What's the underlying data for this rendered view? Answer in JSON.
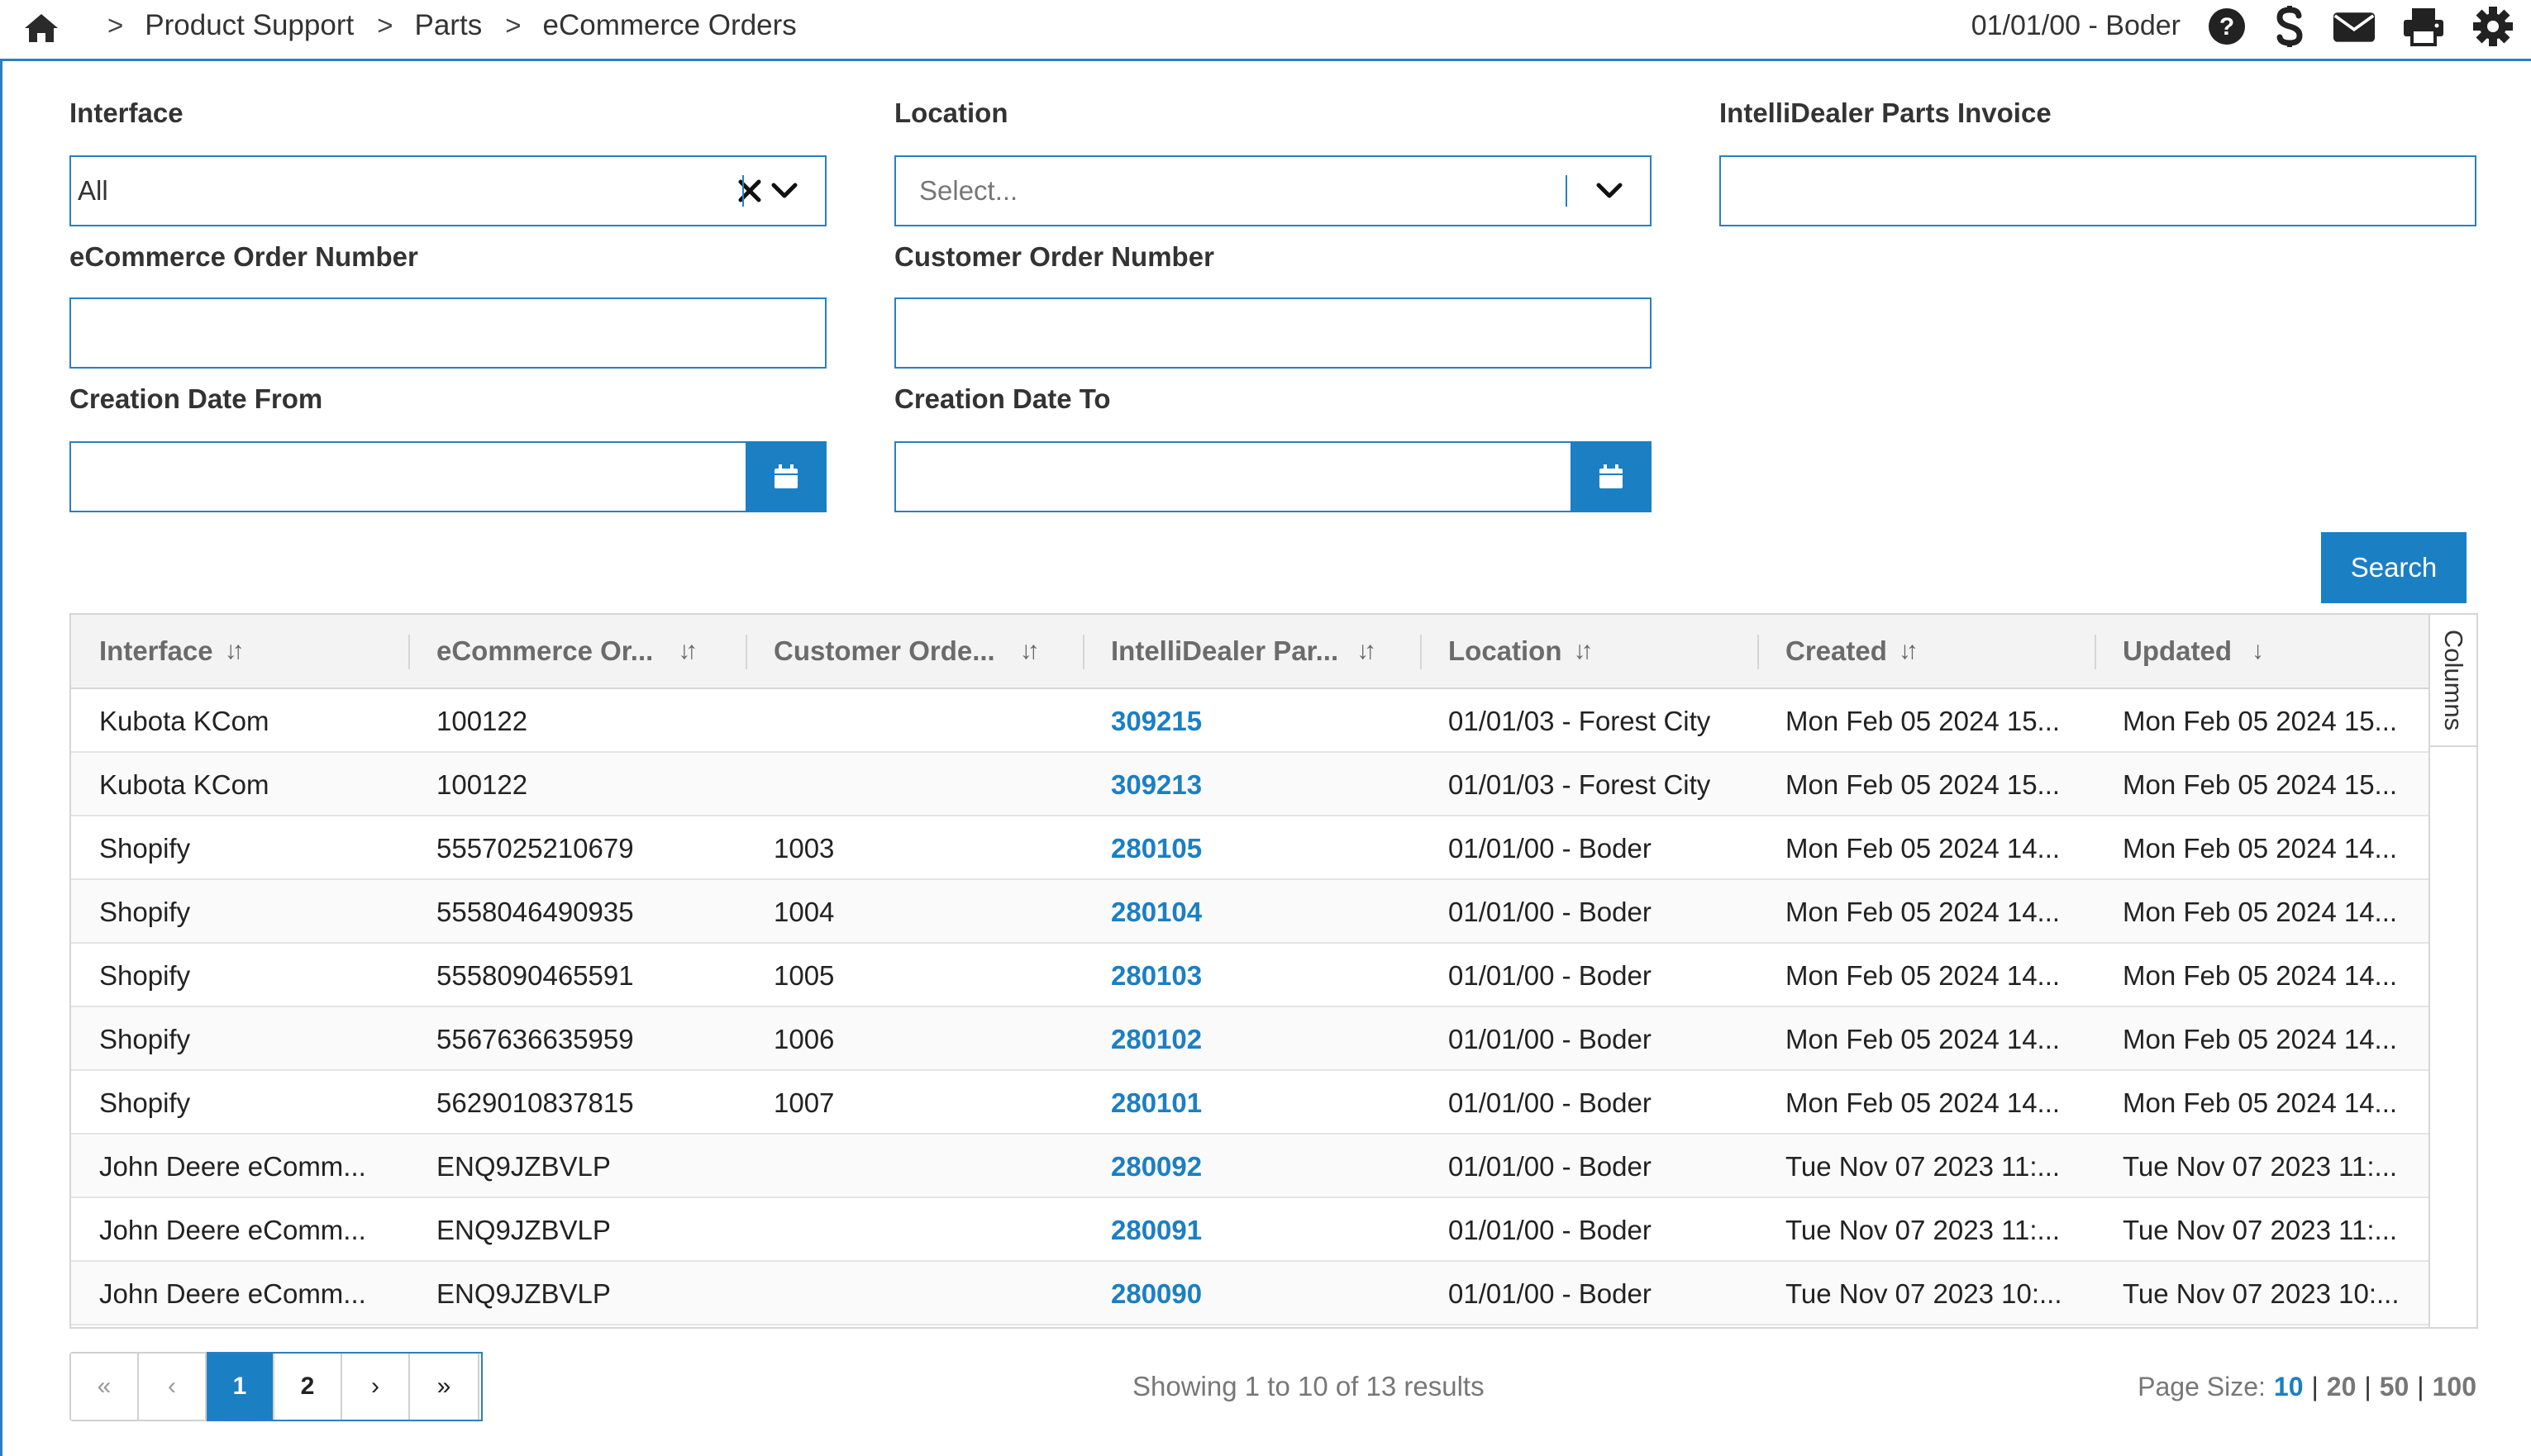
{
  "header": {
    "breadcrumbs": [
      "Product Support",
      "Parts",
      "eCommerce Orders"
    ],
    "separator": ">",
    "user_location": "01/01/00 - Boder",
    "icons": [
      "home-icon",
      "help-icon",
      "dollar-icon",
      "mail-icon",
      "print-icon",
      "gear-icon"
    ]
  },
  "filters": {
    "interface": {
      "label": "Interface",
      "value": "All"
    },
    "location": {
      "label": "Location",
      "placeholder": "Select..."
    },
    "invoice": {
      "label": "IntelliDealer Parts Invoice",
      "value": ""
    },
    "ecom_order": {
      "label": "eCommerce Order Number",
      "value": ""
    },
    "cust_order": {
      "label": "Customer Order Number",
      "value": ""
    },
    "date_from": {
      "label": "Creation Date From",
      "value": ""
    },
    "date_to": {
      "label": "Creation Date To",
      "value": ""
    },
    "search_label": "Search"
  },
  "grid": {
    "columns": [
      "Interface",
      "eCommerce Or...",
      "Customer Orde...",
      "IntelliDealer Par...",
      "Location",
      "Created",
      "Updated"
    ],
    "sort_glyphs": [
      "↓↑",
      "↓↑",
      "↓↑",
      "↓↑",
      "↓↑",
      "↓↑",
      "↓"
    ],
    "side_tab": "Columns",
    "rows": [
      [
        "Kubota KCom",
        "100122",
        "",
        "309215",
        "01/01/03 - Forest City",
        "Mon Feb 05 2024 15...",
        "Mon Feb 05 2024 15..."
      ],
      [
        "Kubota KCom",
        "100122",
        "",
        "309213",
        "01/01/03 - Forest City",
        "Mon Feb 05 2024 15...",
        "Mon Feb 05 2024 15..."
      ],
      [
        "Shopify",
        "5557025210679",
        "1003",
        "280105",
        "01/01/00 - Boder",
        "Mon Feb 05 2024 14...",
        "Mon Feb 05 2024 14..."
      ],
      [
        "Shopify",
        "5558046490935",
        "1004",
        "280104",
        "01/01/00 - Boder",
        "Mon Feb 05 2024 14...",
        "Mon Feb 05 2024 14..."
      ],
      [
        "Shopify",
        "5558090465591",
        "1005",
        "280103",
        "01/01/00 - Boder",
        "Mon Feb 05 2024 14...",
        "Mon Feb 05 2024 14..."
      ],
      [
        "Shopify",
        "5567636635959",
        "1006",
        "280102",
        "01/01/00 - Boder",
        "Mon Feb 05 2024 14...",
        "Mon Feb 05 2024 14..."
      ],
      [
        "Shopify",
        "5629010837815",
        "1007",
        "280101",
        "01/01/00 - Boder",
        "Mon Feb 05 2024 14...",
        "Mon Feb 05 2024 14..."
      ],
      [
        "John Deere eComm...",
        "ENQ9JZBVLP",
        "",
        "280092",
        "01/01/00 - Boder",
        "Tue Nov 07 2023 11:...",
        "Tue Nov 07 2023 11:..."
      ],
      [
        "John Deere eComm...",
        "ENQ9JZBVLP",
        "",
        "280091",
        "01/01/00 - Boder",
        "Tue Nov 07 2023 11:...",
        "Tue Nov 07 2023 11:..."
      ],
      [
        "John Deere eComm...",
        "ENQ9JZBVLP",
        "",
        "280090",
        "01/01/00 - Boder",
        "Tue Nov 07 2023 10:...",
        "Tue Nov 07 2023 10:..."
      ]
    ]
  },
  "pager": {
    "buttons": [
      "«",
      "‹",
      "1",
      "2",
      "›",
      "»"
    ],
    "current_page": "1",
    "showing": "Showing 1 to 10 of 13 results",
    "page_size_label": "Page Size:",
    "page_sizes": [
      "10",
      "20",
      "50",
      "100"
    ],
    "page_size_current": "10"
  },
  "colors": {
    "accent": "#1b7fc4",
    "border": "#2b7fc2",
    "header_bg": "#f3f3f3"
  }
}
